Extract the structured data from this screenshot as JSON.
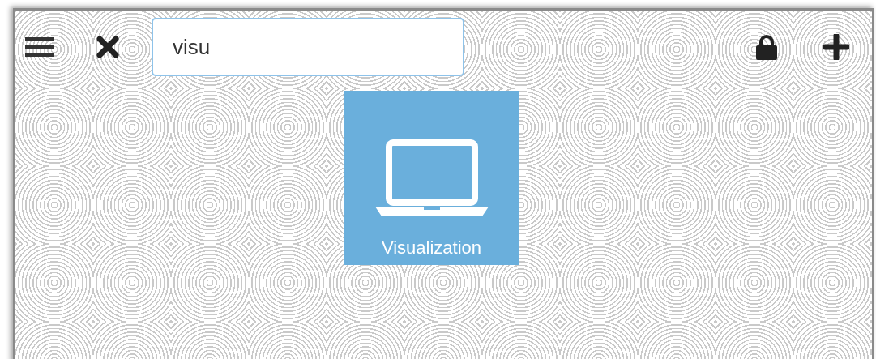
{
  "search": {
    "value": "visu"
  },
  "tiles": [
    {
      "label": "Visualization",
      "kind": "laptop"
    }
  ]
}
